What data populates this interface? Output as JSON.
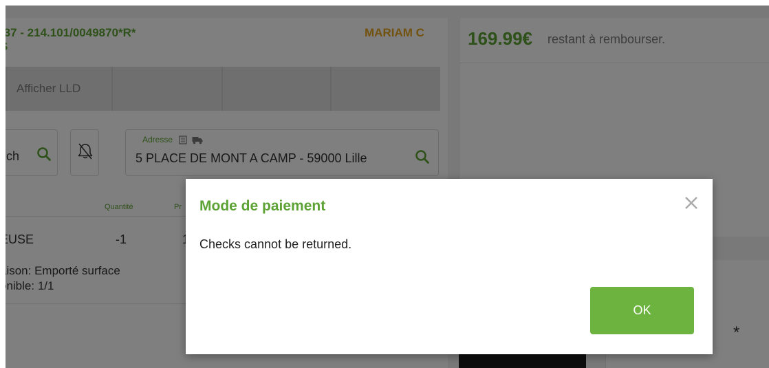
{
  "order": {
    "reference": ":37 - 214.101/0049870*R*",
    "sub_reference": "S",
    "customer": "MARIAM C"
  },
  "tabs": [
    {
      "label": ""
    },
    {
      "label": "Afficher LLD"
    },
    {
      "label": ""
    },
    {
      "label": ""
    },
    {
      "label": ""
    }
  ],
  "search": {
    "value": "ch"
  },
  "address": {
    "label": "Adresse",
    "value": "5 PLACE DE MONT A CAMP - 59000 Lille"
  },
  "lines": {
    "columns": {
      "quantity": "Quantité",
      "price": "Pr"
    },
    "product": "EUSE",
    "quantity": "-1",
    "price_fragment": "1",
    "delivery": "aison: Emporté surface",
    "stock": "onible: 1/1"
  },
  "refund": {
    "amount": "169.99€",
    "label": "restant à rembourser."
  },
  "right_lower": {
    "asterisk": "*"
  },
  "modal": {
    "title": "Mode de paiement",
    "message": "Checks cannot be returned.",
    "ok_label": "OK"
  },
  "colors": {
    "brand_green": "#5ca234",
    "button_green": "#6db33f",
    "customer_orange": "#e4a41e"
  }
}
